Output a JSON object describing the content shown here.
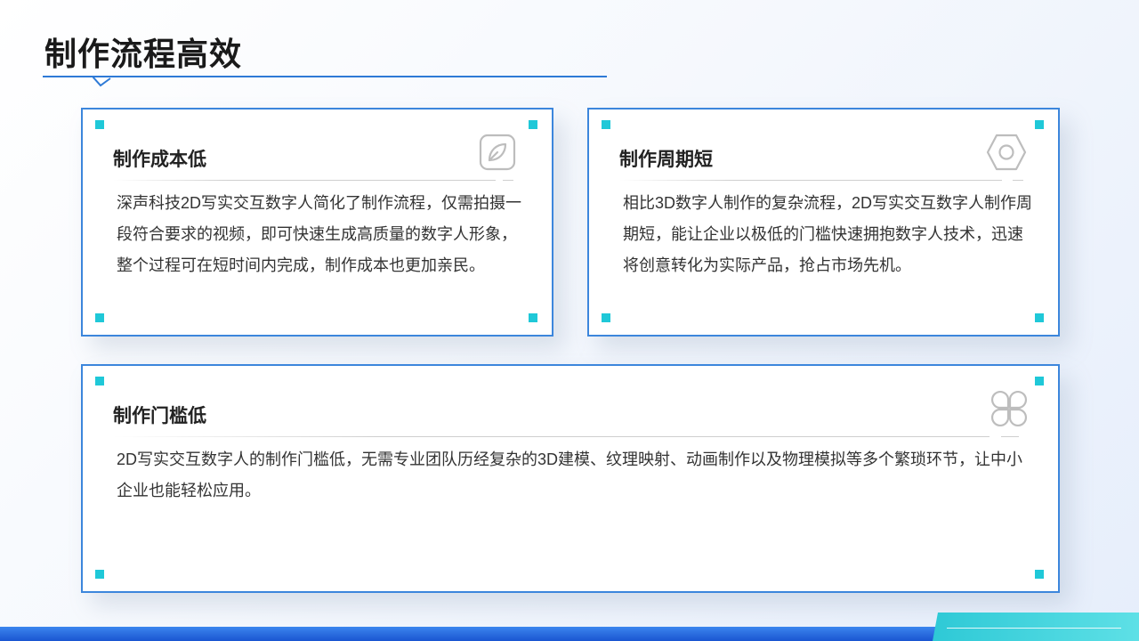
{
  "page": {
    "title": "制作流程高效"
  },
  "cards": [
    {
      "title": "制作成本低",
      "body": "深声科技2D写实交互数字人简化了制作流程，仅需拍摄一段符合要求的视频，即可快速生成高质量的数字人形象，整个过程可在短时间内完成，制作成本也更加亲民。",
      "icon": "leaf-icon"
    },
    {
      "title": "制作周期短",
      "body": "相比3D数字人制作的复杂流程，2D写实交互数字人制作周期短，能让企业以极低的门槛快速拥抱数字人技术，迅速将创意转化为实际产品，抢占市场先机。",
      "icon": "hex-nut-icon"
    },
    {
      "title": "制作门槛低",
      "body": "2D写实交互数字人的制作门槛低，无需专业团队历经复杂的3D建模、纹理映射、动画制作以及物理模拟等多个繁琐环节，让中小企业也能轻松应用。",
      "icon": "clover-icon"
    }
  ],
  "colors": {
    "accent_blue": "#3c86dc",
    "corner_cyan": "#1fc8d8",
    "bottom_bar": "#1a55d1",
    "bottom_tab": "#2ec9d6"
  }
}
